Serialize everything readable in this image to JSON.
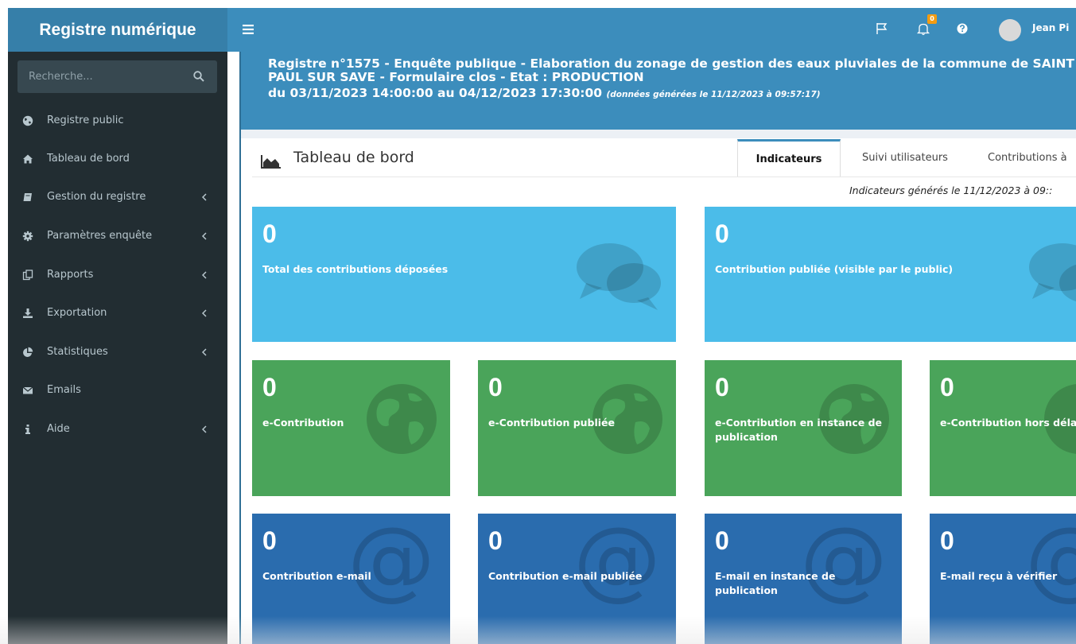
{
  "sidebar": {
    "brand": "Registre numérique",
    "search_placeholder": "Recherche...",
    "items": [
      {
        "label": "Registre public",
        "icon": "globe-icon"
      },
      {
        "label": "Tableau de bord",
        "icon": "home-icon"
      },
      {
        "label": "Gestion du registre",
        "icon": "book-icon"
      },
      {
        "label": "Paramètres enquête",
        "icon": "cog-icon"
      },
      {
        "label": "Rapports",
        "icon": "copy-icon"
      },
      {
        "label": "Exportation",
        "icon": "download-icon"
      },
      {
        "label": "Statistiques",
        "icon": "pie-chart-icon"
      },
      {
        "label": "Emails",
        "icon": "envelope-icon"
      },
      {
        "label": "Aide",
        "icon": "info-icon"
      }
    ]
  },
  "header": {
    "notification_count": "0",
    "user_name": "Jean Pi"
  },
  "banner": {
    "line1": "Registre n°1575 - Enquête publique - Elaboration du zonage de gestion des eaux pluviales de la commune de SAINT",
    "line2": "PAUL SUR SAVE - Formulaire clos - Etat : PRODUCTION",
    "line3": "du 03/11/2023 14:00:00 au 04/12/2023 17:30:00",
    "generated": "(données générées le 11/12/2023 à 09:57:17)"
  },
  "dashboard": {
    "title": "Tableau de bord",
    "tabs": [
      "Indicateurs",
      "Suivi utilisateurs",
      "Contributions à"
    ],
    "active_tab": "Indicateurs",
    "generated_note": "Indicateurs générés le 11/12/2023 à 09::",
    "tiles": [
      {
        "value": "0",
        "label": "Total des contributions déposées"
      },
      {
        "value": "0",
        "label": "Contribution publiée (visible par le public)"
      },
      {
        "value": "0",
        "label": "e-Contribution"
      },
      {
        "value": "0",
        "label": "e-Contribution publiée"
      },
      {
        "value": "0",
        "label": "e-Contribution en instance de publication"
      },
      {
        "value": "0",
        "label": "e-Contribution hors déla"
      },
      {
        "value": "0",
        "label": "Contribution e-mail"
      },
      {
        "value": "0",
        "label": "Contribution e-mail publiée"
      },
      {
        "value": "0",
        "label": "E-mail en instance de publication"
      },
      {
        "value": "0",
        "label": "E-mail reçu à vérifier"
      }
    ]
  },
  "colors": {
    "brand": "#367fa9",
    "header": "#3c8dbc",
    "sidebar": "#222d32",
    "tile_aqua": "#4bbce9",
    "tile_green": "#4aa45a",
    "tile_blue": "#2a6cae",
    "badge": "#f39c12"
  }
}
